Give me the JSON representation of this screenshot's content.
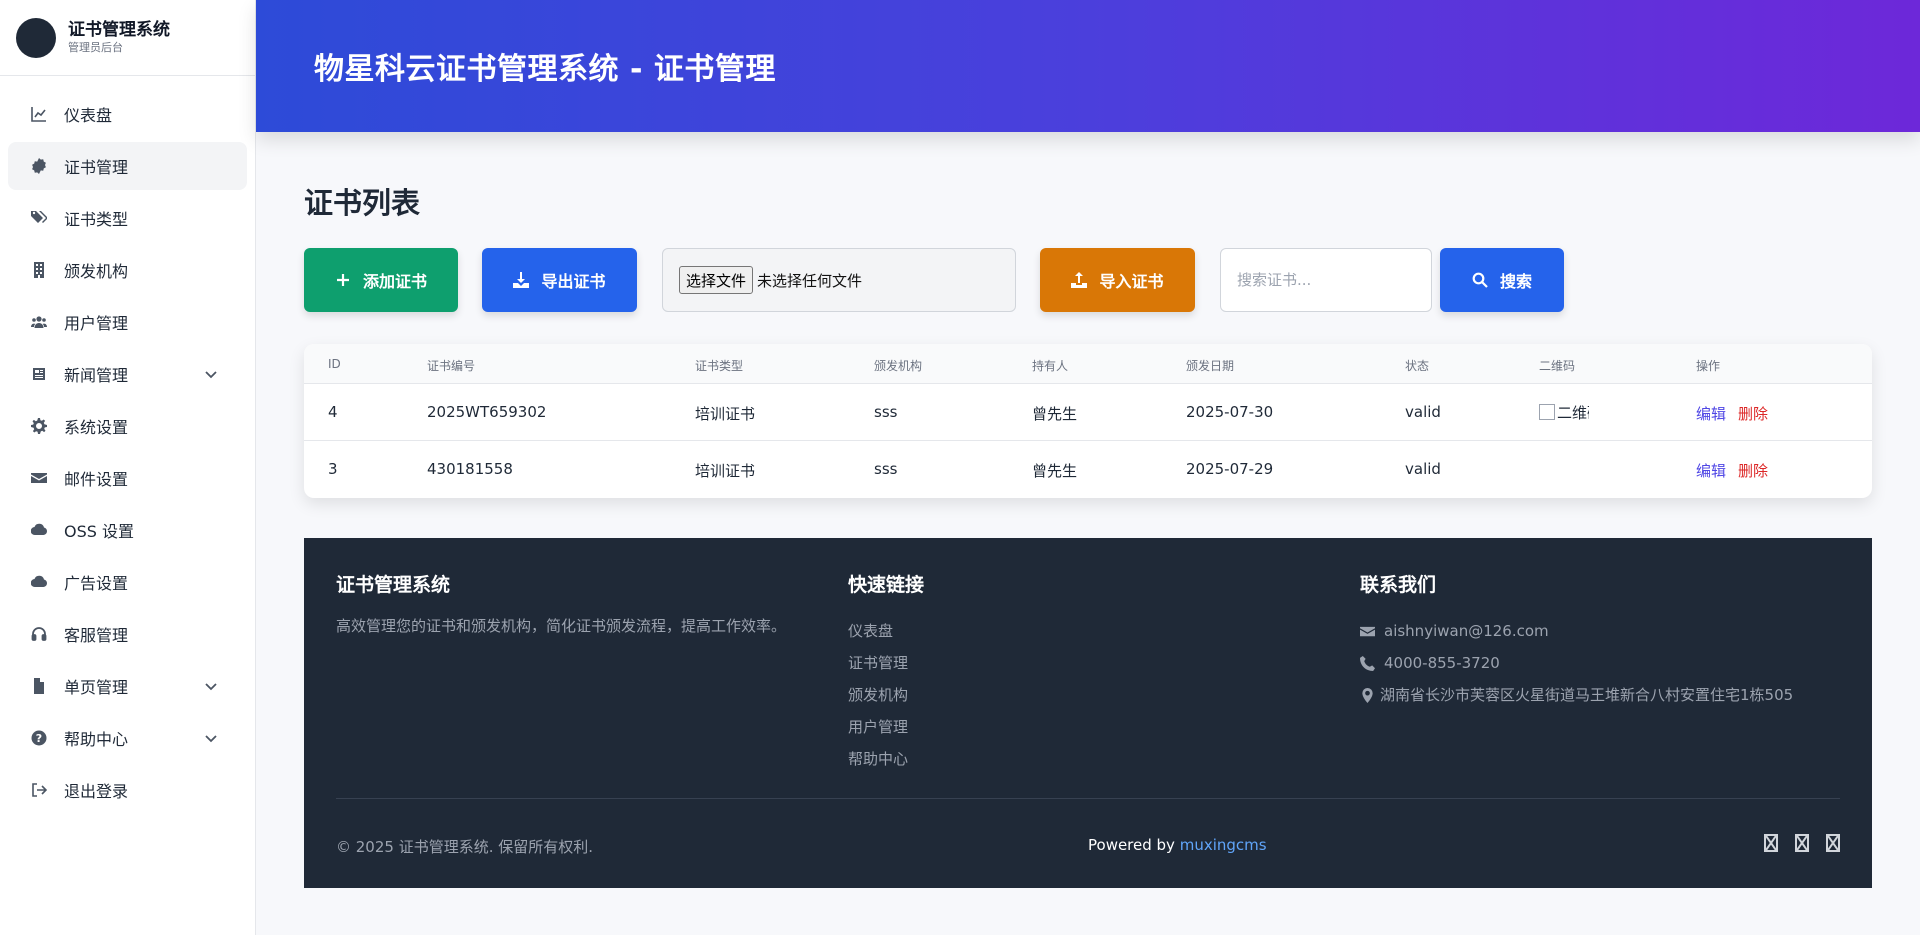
{
  "brand": {
    "title": "证书管理系统",
    "subtitle": "管理员后台"
  },
  "sidebar": {
    "items": [
      {
        "label": "仪表盘",
        "icon": "chart-line-icon"
      },
      {
        "label": "证书管理",
        "icon": "certificate-icon",
        "active": true
      },
      {
        "label": "证书类型",
        "icon": "tags-icon"
      },
      {
        "label": "颁发机构",
        "icon": "building-icon"
      },
      {
        "label": "用户管理",
        "icon": "users-icon"
      },
      {
        "label": "新闻管理",
        "icon": "newspaper-icon",
        "expandable": true
      },
      {
        "label": "系统设置",
        "icon": "gear-icon"
      },
      {
        "label": "邮件设置",
        "icon": "envelope-icon"
      },
      {
        "label": "OSS 设置",
        "icon": "cloud-icon"
      },
      {
        "label": "广告设置",
        "icon": "cloud-icon"
      },
      {
        "label": "客服管理",
        "icon": "headset-icon"
      },
      {
        "label": "单页管理",
        "icon": "file-icon",
        "expandable": true
      },
      {
        "label": "帮助中心",
        "icon": "question-circle-icon",
        "expandable": true
      },
      {
        "label": "退出登录",
        "icon": "sign-out-icon"
      }
    ]
  },
  "header": {
    "title": "物星科云证书管理系统 - 证书管理"
  },
  "main": {
    "title": "证书列表",
    "toolbar": {
      "add_label": "添加证书",
      "export_label": "导出证书",
      "file_button": "选择文件",
      "file_status": "未选择任何文件",
      "import_label": "导入证书",
      "search_placeholder": "搜索证书...",
      "search_label": "搜索"
    },
    "table": {
      "headers": [
        "ID",
        "证书编号",
        "证书类型",
        "颁发机构",
        "持有人",
        "颁发日期",
        "状态",
        "二维码",
        "操作"
      ],
      "rows": [
        {
          "id": "4",
          "number": "2025WT659302",
          "type": "培训证书",
          "issuer": "sss",
          "holder": "曾先生",
          "date": "2025-07-30",
          "status": "valid",
          "qr_alt": "二维码",
          "edit": "编辑",
          "delete": "删除"
        },
        {
          "id": "3",
          "number": "430181558",
          "type": "培训证书",
          "issuer": "sss",
          "holder": "曾先生",
          "date": "2025-07-29",
          "status": "valid",
          "qr_alt": "",
          "edit": "编辑",
          "delete": "删除"
        }
      ]
    }
  },
  "footer": {
    "about": {
      "heading": "证书管理系统",
      "text": "高效管理您的证书和颁发机构，简化证书颁发流程，提高工作效率。"
    },
    "links": {
      "heading": "快速链接",
      "items": [
        "仪表盘",
        "证书管理",
        "颁发机构",
        "用户管理",
        "帮助中心"
      ]
    },
    "contact": {
      "heading": "联系我们",
      "email": "aishnyiwan@126.com",
      "phone": "4000-855-3720",
      "address": "湖南省长沙市芙蓉区火星街道马王堆新合八村安置住宅1栋505"
    },
    "copyright": "© 2025 证书管理系统. 保留所有权利.",
    "powered_prefix": "Powered by ",
    "powered_link": "muxingcms"
  },
  "colors": {
    "add": "#0e9f6e",
    "export": "#2563eb",
    "import": "#d97706",
    "search": "#2563eb",
    "footer_bg": "#1f2937",
    "header_start": "#2d4bd8",
    "header_end": "#6d28d9"
  }
}
